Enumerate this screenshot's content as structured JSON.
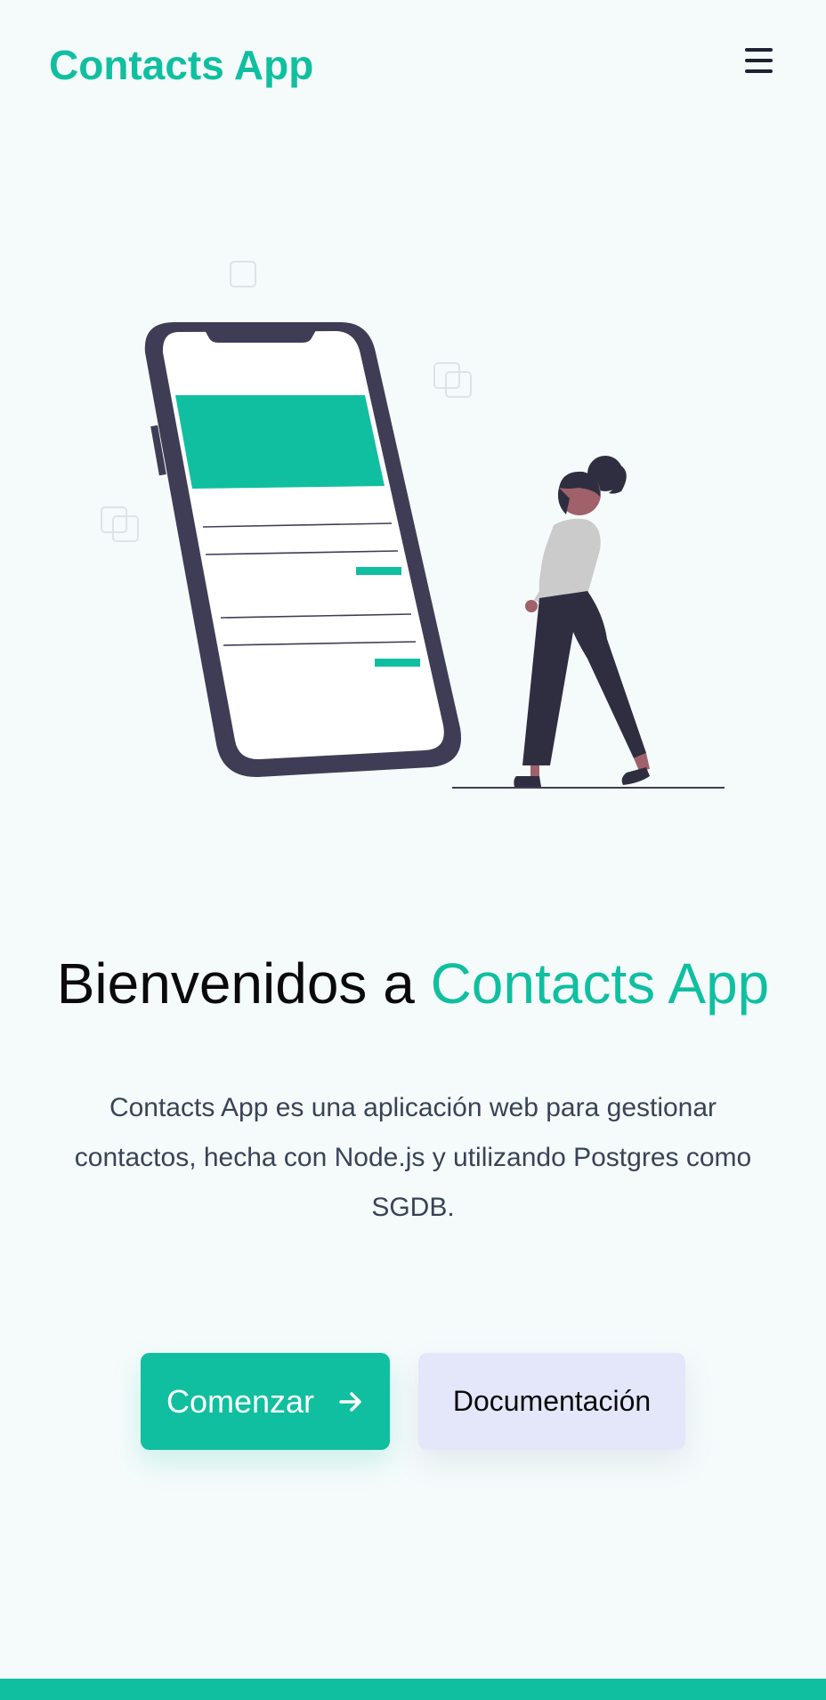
{
  "navbar": {
    "brand": "Contacts App",
    "menu_icon": "hamburger-menu-icon"
  },
  "hero": {
    "title_prefix": "Bienvenidos a",
    "title_accent": "Contacts App",
    "description": "Contacts App es una aplicación web para gestionar contactos, hecha con Node.js y utilizando Postgres como SGDB.",
    "illustration": "woman-looking-at-phone-illustration"
  },
  "buttons": {
    "primary_label": "Comenzar",
    "primary_icon": "arrow-right-icon",
    "secondary_label": "Documentación"
  },
  "colors": {
    "accent": "#10bfa0",
    "background": "#f5fbfb",
    "secondary_button": "#e3e7f9",
    "dark": "#3f3d56"
  }
}
